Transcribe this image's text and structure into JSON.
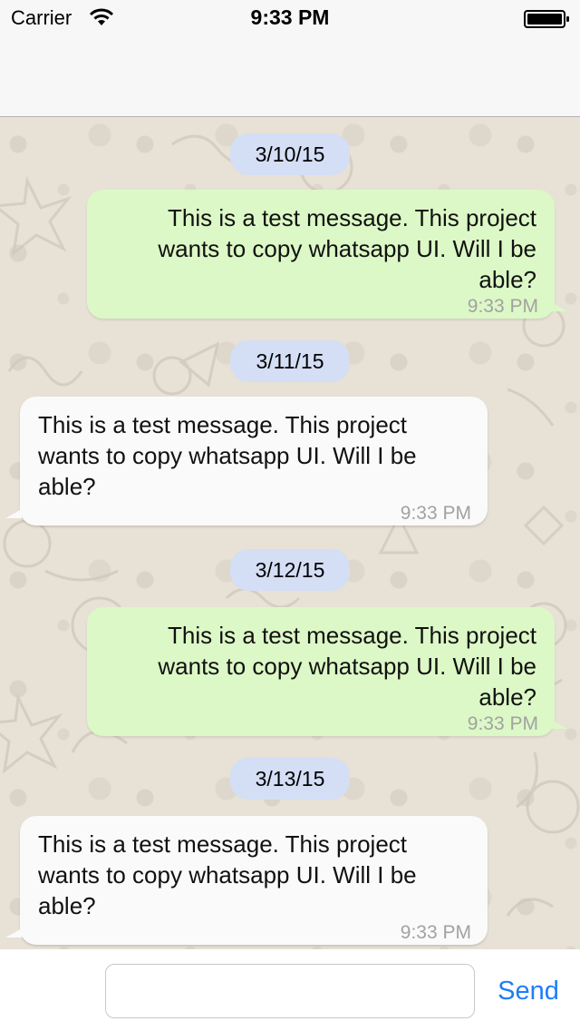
{
  "status_bar": {
    "carrier": "Carrier",
    "time": "9:33 PM"
  },
  "colors": {
    "outgoing_bubble": "#dcf8c6",
    "incoming_bubble": "#fafafa",
    "date_pill": "#d4def5",
    "send_accent": "#1e7ef7",
    "chat_background": "#e7e1d6"
  },
  "messages": [
    {
      "date": "3/10/15",
      "direction": "outgoing",
      "text": "This is a test message. This project wants to copy whatsapp UI. Will I be able?",
      "time": "9:33 PM"
    },
    {
      "date": "3/11/15",
      "direction": "incoming",
      "text": "This is a test message. This project wants to copy whatsapp UI. Will I be able?",
      "time": "9:33 PM"
    },
    {
      "date": "3/12/15",
      "direction": "outgoing",
      "text": "This is a test message. This project wants to copy whatsapp UI. Will I be able?",
      "time": "9:33 PM"
    },
    {
      "date": "3/13/15",
      "direction": "incoming",
      "text": "This is a test message. This project wants to copy whatsapp UI. Will I be able?",
      "time": "9:33 PM"
    }
  ],
  "composer": {
    "input_value": "",
    "send_label": "Send"
  }
}
